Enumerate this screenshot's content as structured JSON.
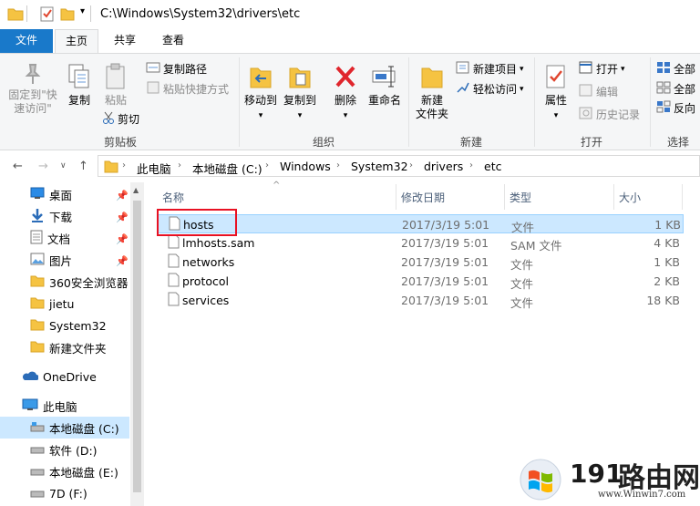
{
  "window": {
    "title": "C:\\Windows\\System32\\drivers\\etc"
  },
  "ribbon_tabs": [
    "文件",
    "主页",
    "共享",
    "查看"
  ],
  "ribbon": {
    "clipboard": {
      "pin_quick_access": "固定到\"快\n速访问\"",
      "copy": "复制",
      "paste": "粘贴",
      "copy_path": "复制路径",
      "paste_shortcut": "粘贴快捷方式",
      "cut": "剪切",
      "label": "剪贴板"
    },
    "organize": {
      "move_to": "移动到",
      "copy_to": "复制到",
      "delete": "删除",
      "rename": "重命名",
      "label": "组织"
    },
    "new": {
      "new_folder": "新建\n文件夹",
      "new_item": "新建项目",
      "easy_access": "轻松访问",
      "label": "新建"
    },
    "open": {
      "properties": "属性",
      "open": "打开",
      "edit": "编辑",
      "history": "历史记录",
      "label": "打开"
    },
    "select": {
      "select_all": "全部",
      "select_none": "全部",
      "invert": "反向",
      "label": "选择"
    }
  },
  "address": {
    "crumbs": [
      "此电脑",
      "本地磁盘 (C:)",
      "Windows",
      "System32",
      "drivers",
      "etc"
    ]
  },
  "nav_pane": {
    "items": [
      {
        "label": "桌面",
        "icon": "desktop-icon",
        "pinned": true
      },
      {
        "label": "下载",
        "icon": "download-icon",
        "pinned": true
      },
      {
        "label": "文档",
        "icon": "documents-icon",
        "pinned": true
      },
      {
        "label": "图片",
        "icon": "pictures-icon",
        "pinned": true
      },
      {
        "label": "360安全浏览器",
        "icon": "folder-icon",
        "pinned": false
      },
      {
        "label": "jietu",
        "icon": "folder-icon",
        "pinned": false
      },
      {
        "label": "System32",
        "icon": "folder-icon",
        "pinned": false
      },
      {
        "label": "新建文件夹",
        "icon": "folder-icon",
        "pinned": false
      },
      {
        "label": "OneDrive",
        "icon": "onedrive-icon",
        "pinned": false
      },
      {
        "label": "此电脑",
        "icon": "computer-icon",
        "pinned": false
      },
      {
        "label": "本地磁盘 (C:)",
        "icon": "drive-icon",
        "pinned": false
      },
      {
        "label": "软件 (D:)",
        "icon": "drive-icon",
        "pinned": false
      },
      {
        "label": "本地磁盘 (E:)",
        "icon": "drive-icon",
        "pinned": false
      },
      {
        "label": "7D (F:)",
        "icon": "drive-icon",
        "pinned": false
      }
    ]
  },
  "file_list": {
    "columns": [
      "名称",
      "修改日期",
      "类型",
      "大小"
    ],
    "rows": [
      {
        "name": "hosts",
        "date": "2017/3/19 5:01",
        "type": "文件",
        "size": "1 KB",
        "selected": true
      },
      {
        "name": "lmhosts.sam",
        "date": "2017/3/19 5:01",
        "type": "SAM 文件",
        "size": "4 KB",
        "selected": false
      },
      {
        "name": "networks",
        "date": "2017/3/19 5:01",
        "type": "文件",
        "size": "1 KB",
        "selected": false
      },
      {
        "name": "protocol",
        "date": "2017/3/19 5:01",
        "type": "文件",
        "size": "2 KB",
        "selected": false
      },
      {
        "name": "services",
        "date": "2017/3/19 5:01",
        "type": "文件",
        "size": "18 KB",
        "selected": false
      }
    ]
  },
  "watermark": {
    "number": "191",
    "chinese": "路由网",
    "url": "www.Winwin7.com"
  },
  "colors": {
    "accent": "#1979ca",
    "selection": "#cce8ff",
    "highlight_box": "#e81123",
    "folder": "#f5c342"
  }
}
